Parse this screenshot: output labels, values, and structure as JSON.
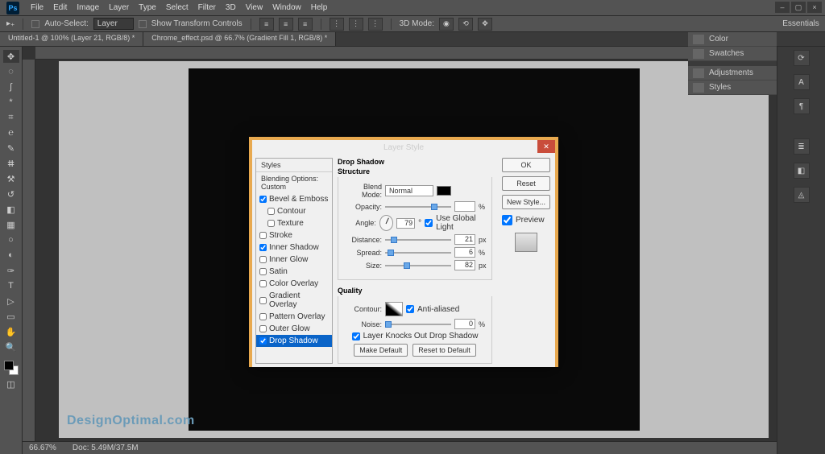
{
  "menu": [
    "File",
    "Edit",
    "Image",
    "Layer",
    "Type",
    "Select",
    "Filter",
    "3D",
    "View",
    "Window",
    "Help"
  ],
  "options": {
    "auto_select": "Auto-Select:",
    "auto_select_on": true,
    "target": "Layer",
    "show_transform": "Show Transform Controls",
    "threeD": "3D Mode:"
  },
  "essentials": "Essentials",
  "tabs": [
    "Untitled-1 @ 100% (Layer 21, RGB/8) *",
    "Chrome_effect.psd @ 66.7% (Gradient Fill 1, RGB/8) *"
  ],
  "side_panels": [
    "Color",
    "Swatches",
    "Adjustments",
    "Styles"
  ],
  "status": {
    "zoom": "66.67%",
    "doc": "Doc: 5.49M/37.5M"
  },
  "watermark": "DesignOptimal.com",
  "dialog": {
    "title": "Layer Style",
    "left": {
      "styles": "Styles",
      "blending": "Blending Options: Custom",
      "items": [
        {
          "label": "Bevel & Emboss",
          "checked": true
        },
        {
          "label": "Contour",
          "checked": false,
          "indent": true
        },
        {
          "label": "Texture",
          "checked": false,
          "indent": true
        },
        {
          "label": "Stroke",
          "checked": false
        },
        {
          "label": "Inner Shadow",
          "checked": true
        },
        {
          "label": "Inner Glow",
          "checked": false
        },
        {
          "label": "Satin",
          "checked": false
        },
        {
          "label": "Color Overlay",
          "checked": false
        },
        {
          "label": "Gradient Overlay",
          "checked": false
        },
        {
          "label": "Pattern Overlay",
          "checked": false
        },
        {
          "label": "Outer Glow",
          "checked": false
        },
        {
          "label": "Drop Shadow",
          "checked": true,
          "selected": true
        }
      ]
    },
    "mid": {
      "title": "Drop Shadow",
      "structure": "Structure",
      "blend_mode_l": "Blend Mode:",
      "blend_mode": "Normal",
      "opacity_l": "Opacity:",
      "opacity_unit": "%",
      "angle_l": "Angle:",
      "angle_v": "79",
      "global": "Use Global Light",
      "distance_l": "Distance:",
      "distance_v": "21",
      "dist_u": "px",
      "spread_l": "Spread:",
      "spread_v": "6",
      "spread_u": "%",
      "size_l": "Size:",
      "size_v": "82",
      "size_u": "px",
      "quality": "Quality",
      "contour_l": "Contour:",
      "anti": "Anti-aliased",
      "noise_l": "Noise:",
      "noise_v": "0",
      "noise_u": "%",
      "knock": "Layer Knocks Out Drop Shadow",
      "make_default": "Make Default",
      "reset_default": "Reset to Default"
    },
    "right": {
      "ok": "OK",
      "reset": "Reset",
      "new_style": "New Style...",
      "preview": "Preview"
    }
  }
}
